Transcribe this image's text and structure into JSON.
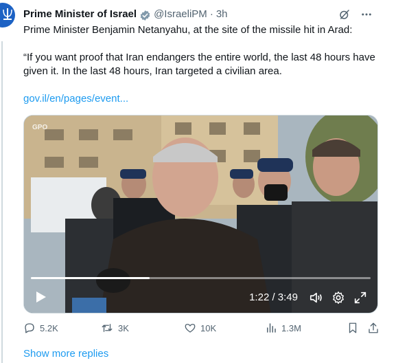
{
  "account": {
    "name": "Prime Minister of Israel",
    "handle": "@IsraeliPM",
    "separator": "·",
    "time": "3h",
    "badge_color": "#829aab"
  },
  "tweet": {
    "line1": "Prime Minister Benjamin Netanyahu, at the site of the missile hit in Arad:",
    "quote": "“If you want proof that Iran endangers the entire world, the last 48 hours have given it. In the last 48 hours, Iran targeted a civilian area.",
    "link": "gov.il/en/pages/event..."
  },
  "video": {
    "watermark": "GPO",
    "timecode": "1:22 / 3:49",
    "progress_fraction": 0.35
  },
  "actions": {
    "reply": "5.2K",
    "retweet": "3K",
    "like": "10K",
    "views": "1.3M"
  },
  "show_more": "Show more replies",
  "colors": {
    "accent": "#1d9bf0",
    "muted": "#536471",
    "text": "#0f1419"
  }
}
